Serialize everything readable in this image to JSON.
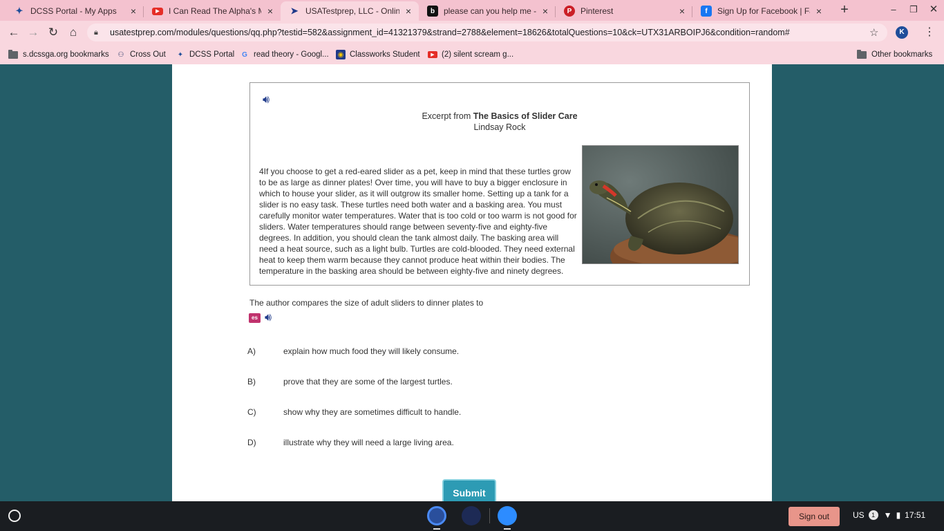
{
  "browser": {
    "tabs": [
      {
        "title": "DCSS Portal - My Apps",
        "icon": "dcss-portal-icon"
      },
      {
        "title": "I Can Read The Alpha's Mind",
        "icon": "youtube-icon"
      },
      {
        "title": "USATestprep, LLC - Online Sta",
        "icon": "usatestprep-icon"
      },
      {
        "title": "please can you help me - Brai",
        "icon": "brainly-icon"
      },
      {
        "title": "Pinterest",
        "icon": "pinterest-icon"
      },
      {
        "title": "Sign Up for Facebook | Faceb",
        "icon": "facebook-icon"
      }
    ],
    "url": "usatestprep.com/modules/questions/qq.php?testid=582&assignment_id=41321379&strand=2788&element=18626&totalQuestions=10&ck=UTX31ARBOIPJ6&condition=random#",
    "profile_initial": "K",
    "bookmarks": [
      "s.dcssga.org bookmarks",
      "Cross Out",
      "DCSS Portal",
      "read theory - Googl...",
      "Classworks Student",
      "(2) silent scream g..."
    ],
    "other_bookmarks": "Other bookmarks"
  },
  "passage": {
    "excerpt_prefix": "Excerpt from",
    "title": "The Basics of Slider Care",
    "author": "Lindsay Rock",
    "text": "4If you choose to get a red-eared slider as a pet, keep in mind that these turtles grow to be as large as dinner plates! Over time, you will have to buy a bigger enclosure in which to house your slider, as it will outgrow its smaller home. Setting up a tank for a slider is no easy task. These turtles need both water and a basking area. You must carefully monitor water temperatures. Water that is too cold or too warm is not good for sliders. Water temperatures should range between seventy-five and eighty-five degrees. In addition, you should clean the tank almost daily. The basking area will need a heat source, such as a light bulb. Turtles are cold-blooded. They need external heat to keep them warm because they cannot produce heat within their bodies. The temperature in the basking area should be between eighty-five and ninety degrees."
  },
  "question": {
    "prompt": "The author compares the size of adult sliders to dinner plates to",
    "es_label": "es",
    "choices": [
      {
        "letter": "A)",
        "text": "explain how much food they will likely consume."
      },
      {
        "letter": "B)",
        "text": "prove that they are some of the largest turtles."
      },
      {
        "letter": "C)",
        "text": "show why they are sometimes difficult to handle."
      },
      {
        "letter": "D)",
        "text": "illustrate why they will need a large living area."
      }
    ],
    "submit_label": "Submit"
  },
  "shelf": {
    "signout_label": "Sign out",
    "locale": "US",
    "notification_count": "1",
    "time": "17:51"
  },
  "colors": {
    "tabstrip": "#f4c2cf",
    "toolbar": "#f9d7df",
    "page_background": "#245d68",
    "submit": "#2d9bb4",
    "signout": "#e8958a"
  }
}
